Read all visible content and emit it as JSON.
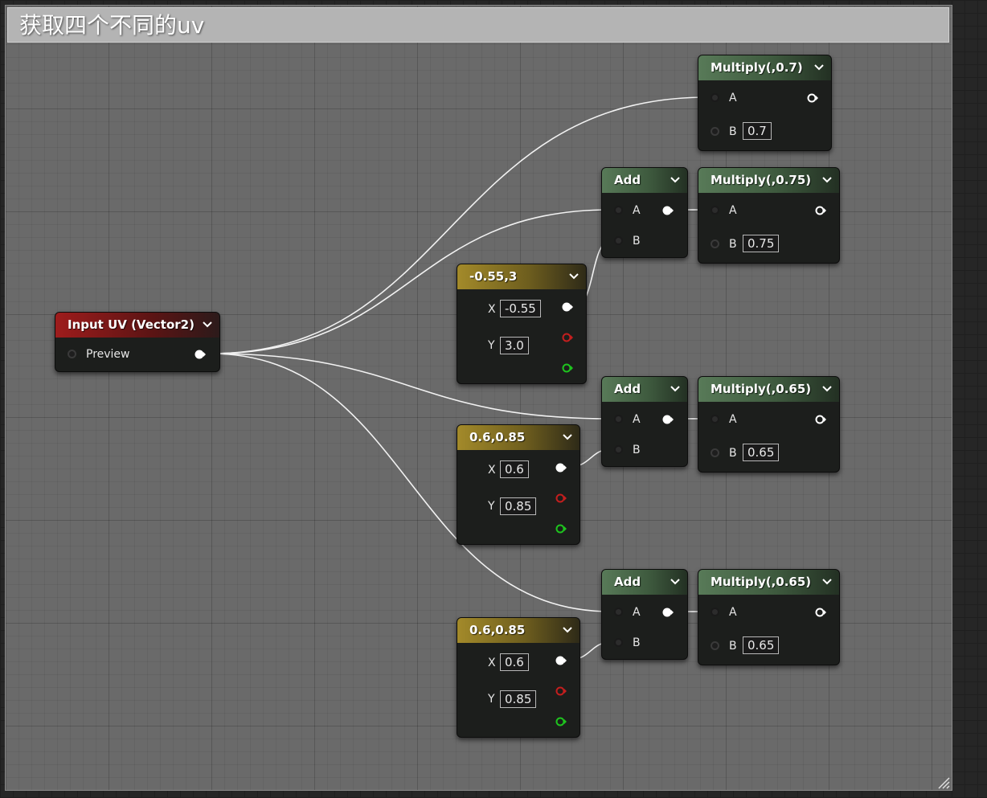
{
  "comment": {
    "title": "获取四个不同的uv"
  },
  "input_node": {
    "title": "Input UV (Vector2)",
    "pin_label": "Preview"
  },
  "vectors": [
    {
      "title": "-0.55,3",
      "x_label": "X",
      "x_value": "-0.55",
      "y_label": "Y",
      "y_value": "3.0"
    },
    {
      "title": "0.6,0.85",
      "x_label": "X",
      "x_value": "0.6",
      "y_label": "Y",
      "y_value": "0.85"
    },
    {
      "title": "0.6,0.85",
      "x_label": "X",
      "x_value": "0.6",
      "y_label": "Y",
      "y_value": "0.85"
    }
  ],
  "adds": [
    {
      "title": "Add",
      "pin_a": "A",
      "pin_b": "B"
    },
    {
      "title": "Add",
      "pin_a": "A",
      "pin_b": "B"
    },
    {
      "title": "Add",
      "pin_a": "A",
      "pin_b": "B"
    }
  ],
  "multiplies": [
    {
      "title": "Multiply(,0.7)",
      "pin_a": "A",
      "pin_b": "B",
      "b_value": "0.7"
    },
    {
      "title": "Multiply(,0.75)",
      "pin_a": "A",
      "pin_b": "B",
      "b_value": "0.75"
    },
    {
      "title": "Multiply(,0.65)",
      "pin_a": "A",
      "pin_b": "B",
      "b_value": "0.65"
    },
    {
      "title": "Multiply(,0.65)",
      "pin_a": "A",
      "pin_b": "B",
      "b_value": "0.65"
    }
  ],
  "colors": {
    "input_header": "#9e1c1c",
    "math_header": "#587a58",
    "constant_header": "#a38a2a",
    "wire": "#f2f2f2",
    "pin_red": "#c41e1e",
    "pin_green": "#1ec41e"
  }
}
